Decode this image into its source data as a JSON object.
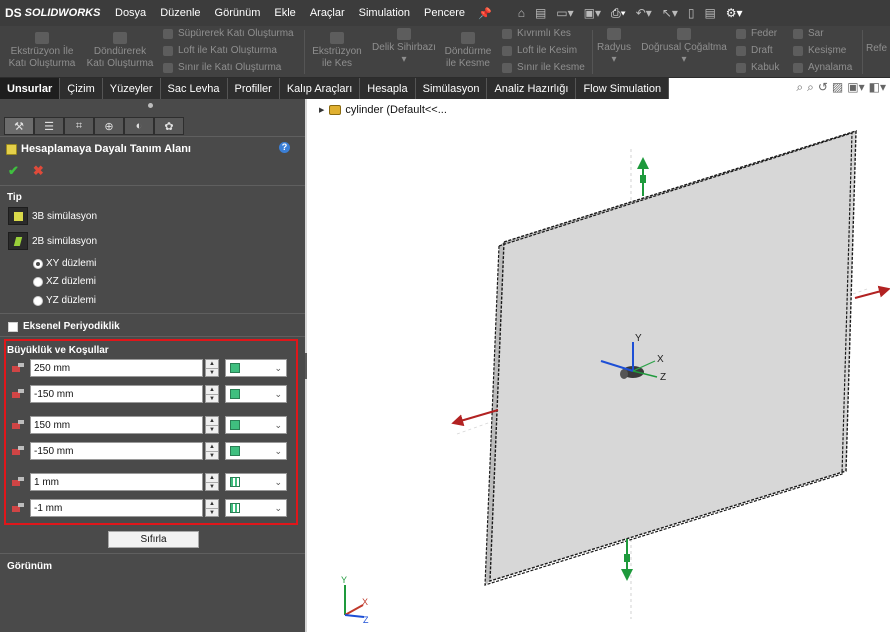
{
  "app": {
    "logo_prefix": "DS",
    "logo_text": "SOLIDWORKS"
  },
  "menu": [
    "Dosya",
    "Düzenle",
    "Görünüm",
    "Ekle",
    "Araçlar",
    "Simulation",
    "Pencere"
  ],
  "ribbon": {
    "extrude_boss": [
      "Ekstrüzyon İle",
      "Katı Oluşturma"
    ],
    "revolve_boss": [
      "Döndürerek",
      "Katı Oluşturma"
    ],
    "sweep_boss": "Süpürerek Katı Oluşturma",
    "loft_boss": "Loft ile Katı Oluşturma",
    "boundary_boss": "Sınır ile Katı Oluşturma",
    "extrude_cut": [
      "Ekstrüzyon",
      "ile Kes"
    ],
    "hole_wizard": "Delik Sihirbazı",
    "revolve_cut": [
      "Döndürme",
      "ile Kesme"
    ],
    "swept_cut": "Kıvrımlı Kes",
    "loft_cut": "Loft ile Kesim",
    "boundary_cut": "Sınır ile Kesme",
    "fillet": "Radyus",
    "linear_pattern": "Doğrusal Çoğaltma",
    "rib": "Feder",
    "draft": "Draft",
    "shell": "Kabuk",
    "wrap": "Sar",
    "intersect": "Kesişme",
    "mirror": "Aynalama",
    "reference": "Refe"
  },
  "tabs": [
    "Unsurlar",
    "Çizim",
    "Yüzeyler",
    "Sac Levha",
    "Profiller",
    "Kalıp Araçları",
    "Hesapla",
    "Simülasyon",
    "Analiz Hazırlığı",
    "Flow Simulation"
  ],
  "panel": {
    "title": "Hesaplamaya Dayalı Tanım Alanı",
    "help": "?",
    "ok": "✔",
    "cancel": "✖",
    "type_section": "Tip",
    "sim_3d": "3B simülasyon",
    "sim_2d": "2B simülasyon",
    "plane_xy": "XY düzlemi",
    "plane_xz": "XZ düzlemi",
    "plane_yz": "YZ düzlemi",
    "axial_periodicity": "Eksenel Periyodiklik",
    "bounds_section": "Büyüklük ve Koşullar",
    "bounds": [
      "250 mm",
      "-150 mm",
      "150 mm",
      "-150 mm",
      "1 mm",
      "-1 mm"
    ],
    "reset": "Sıfırla",
    "view_section": "Görünüm"
  },
  "tree": {
    "part": "cylinder",
    "config": "(Default<<..."
  },
  "triad": {
    "x": "X",
    "y": "Y",
    "z": "Z"
  }
}
